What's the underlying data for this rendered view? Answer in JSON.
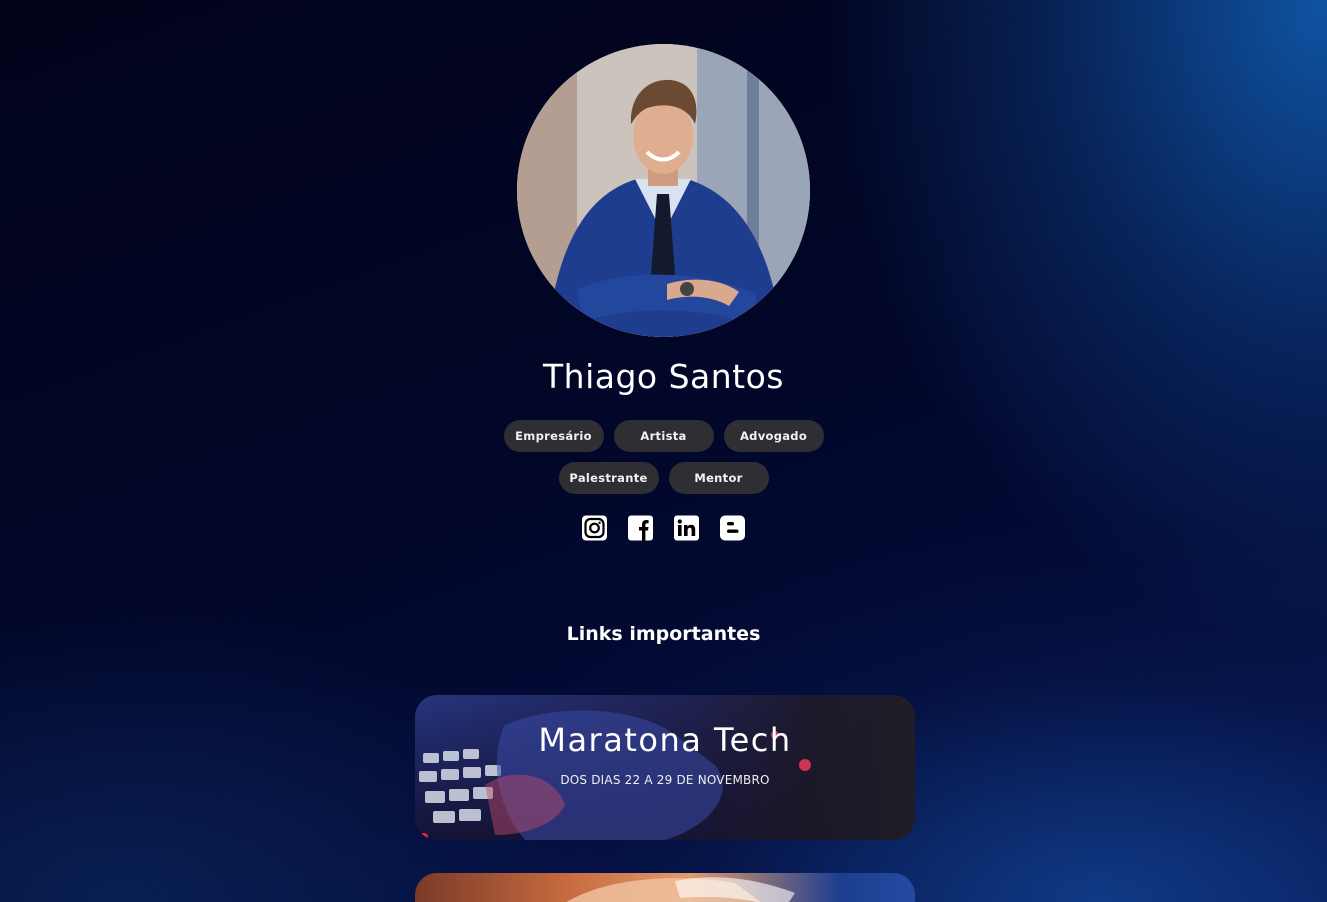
{
  "profile": {
    "name": "Thiago Santos",
    "avatar_icon": "profile-photo"
  },
  "tags": {
    "row1": [
      "Empresário",
      "Artista",
      "Advogado"
    ],
    "row2": [
      "Palestrante",
      "Mentor"
    ]
  },
  "socials": [
    {
      "icon": "instagram-icon"
    },
    {
      "icon": "facebook-icon"
    },
    {
      "icon": "linkedin-icon"
    },
    {
      "icon": "blogger-icon"
    }
  ],
  "links_section": {
    "title": "Links importantes",
    "cards": [
      {
        "title": "Maratona Tech",
        "subtitle": "DOS DIAS 22 A 29 DE NOVEMBRO"
      }
    ]
  },
  "colors": {
    "tag_bg": "#2f2f33",
    "text": "#ffffff",
    "background_dark": "#020626",
    "background_accent": "#1058aa"
  }
}
